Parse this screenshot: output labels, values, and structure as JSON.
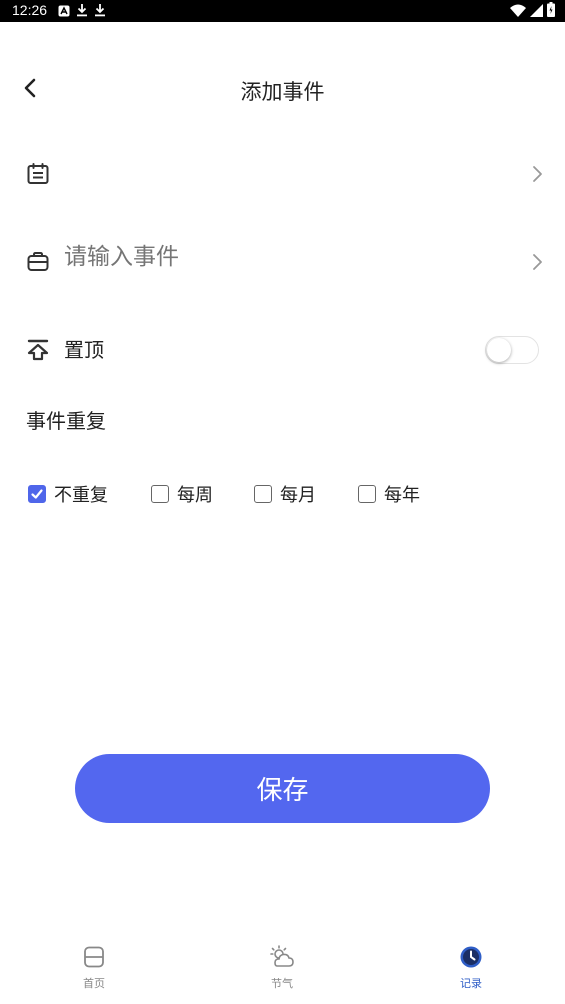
{
  "status_bar": {
    "time": "12:26"
  },
  "header": {
    "title": "添加事件"
  },
  "form": {
    "date_value": "",
    "event_placeholder": "请输入事件",
    "pin_label": "置顶",
    "pin_enabled": false,
    "repeat_title": "事件重复",
    "repeat_options": [
      {
        "label": "不重复",
        "checked": true
      },
      {
        "label": "每周",
        "checked": false
      },
      {
        "label": "每月",
        "checked": false
      },
      {
        "label": "每年",
        "checked": false
      }
    ]
  },
  "save_button": {
    "label": "保存"
  },
  "tab_bar": {
    "items": [
      {
        "label": "首页",
        "icon": "home-card-icon",
        "active": false
      },
      {
        "label": "节气",
        "icon": "weather-sun-cloud-icon",
        "active": false
      },
      {
        "label": "记录",
        "icon": "clock-icon",
        "active": true
      }
    ]
  },
  "colors": {
    "accent": "#5367ef",
    "active_tab": "#2f5ec7",
    "placeholder": "#c4c4c4"
  }
}
